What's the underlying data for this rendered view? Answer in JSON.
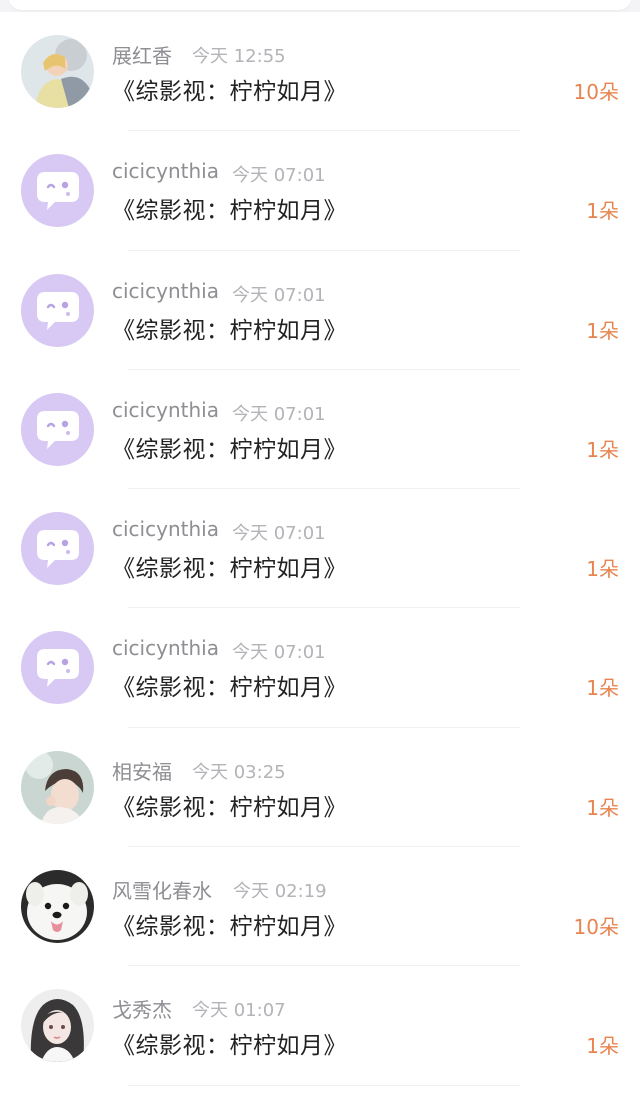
{
  "colors": {
    "accent": "#e8844f",
    "avatar_purple": "#d8c8f4"
  },
  "items": [
    {
      "avatar": "user-photo-avatar",
      "name": "展红香",
      "time": "今天 12:55",
      "title": "《综影视：柠柠如月》",
      "gift": "10朵"
    },
    {
      "avatar": "default-bubble-avatar",
      "name": "cicicynthia",
      "time": "今天 07:01",
      "title": "《综影视：柠柠如月》",
      "gift": "1朵"
    },
    {
      "avatar": "default-bubble-avatar",
      "name": "cicicynthia",
      "time": "今天 07:01",
      "title": "《综影视：柠柠如月》",
      "gift": "1朵"
    },
    {
      "avatar": "default-bubble-avatar",
      "name": "cicicynthia",
      "time": "今天 07:01",
      "title": "《综影视：柠柠如月》",
      "gift": "1朵"
    },
    {
      "avatar": "default-bubble-avatar",
      "name": "cicicynthia",
      "time": "今天 07:01",
      "title": "《综影视：柠柠如月》",
      "gift": "1朵"
    },
    {
      "avatar": "default-bubble-avatar",
      "name": "cicicynthia",
      "time": "今天 07:01",
      "title": "《综影视：柠柠如月》",
      "gift": "1朵"
    },
    {
      "avatar": "user-photo-avatar",
      "name": "相安福",
      "time": "今天 03:25",
      "title": "《综影视：柠柠如月》",
      "gift": "1朵"
    },
    {
      "avatar": "dog-photo-avatar",
      "name": "风雪化春水",
      "time": "今天 02:19",
      "title": "《综影视：柠柠如月》",
      "gift": "10朵"
    },
    {
      "avatar": "user-photo-avatar",
      "name": "戈秀杰",
      "time": "今天 01:07",
      "title": "《综影视：柠柠如月》",
      "gift": "1朵"
    }
  ]
}
